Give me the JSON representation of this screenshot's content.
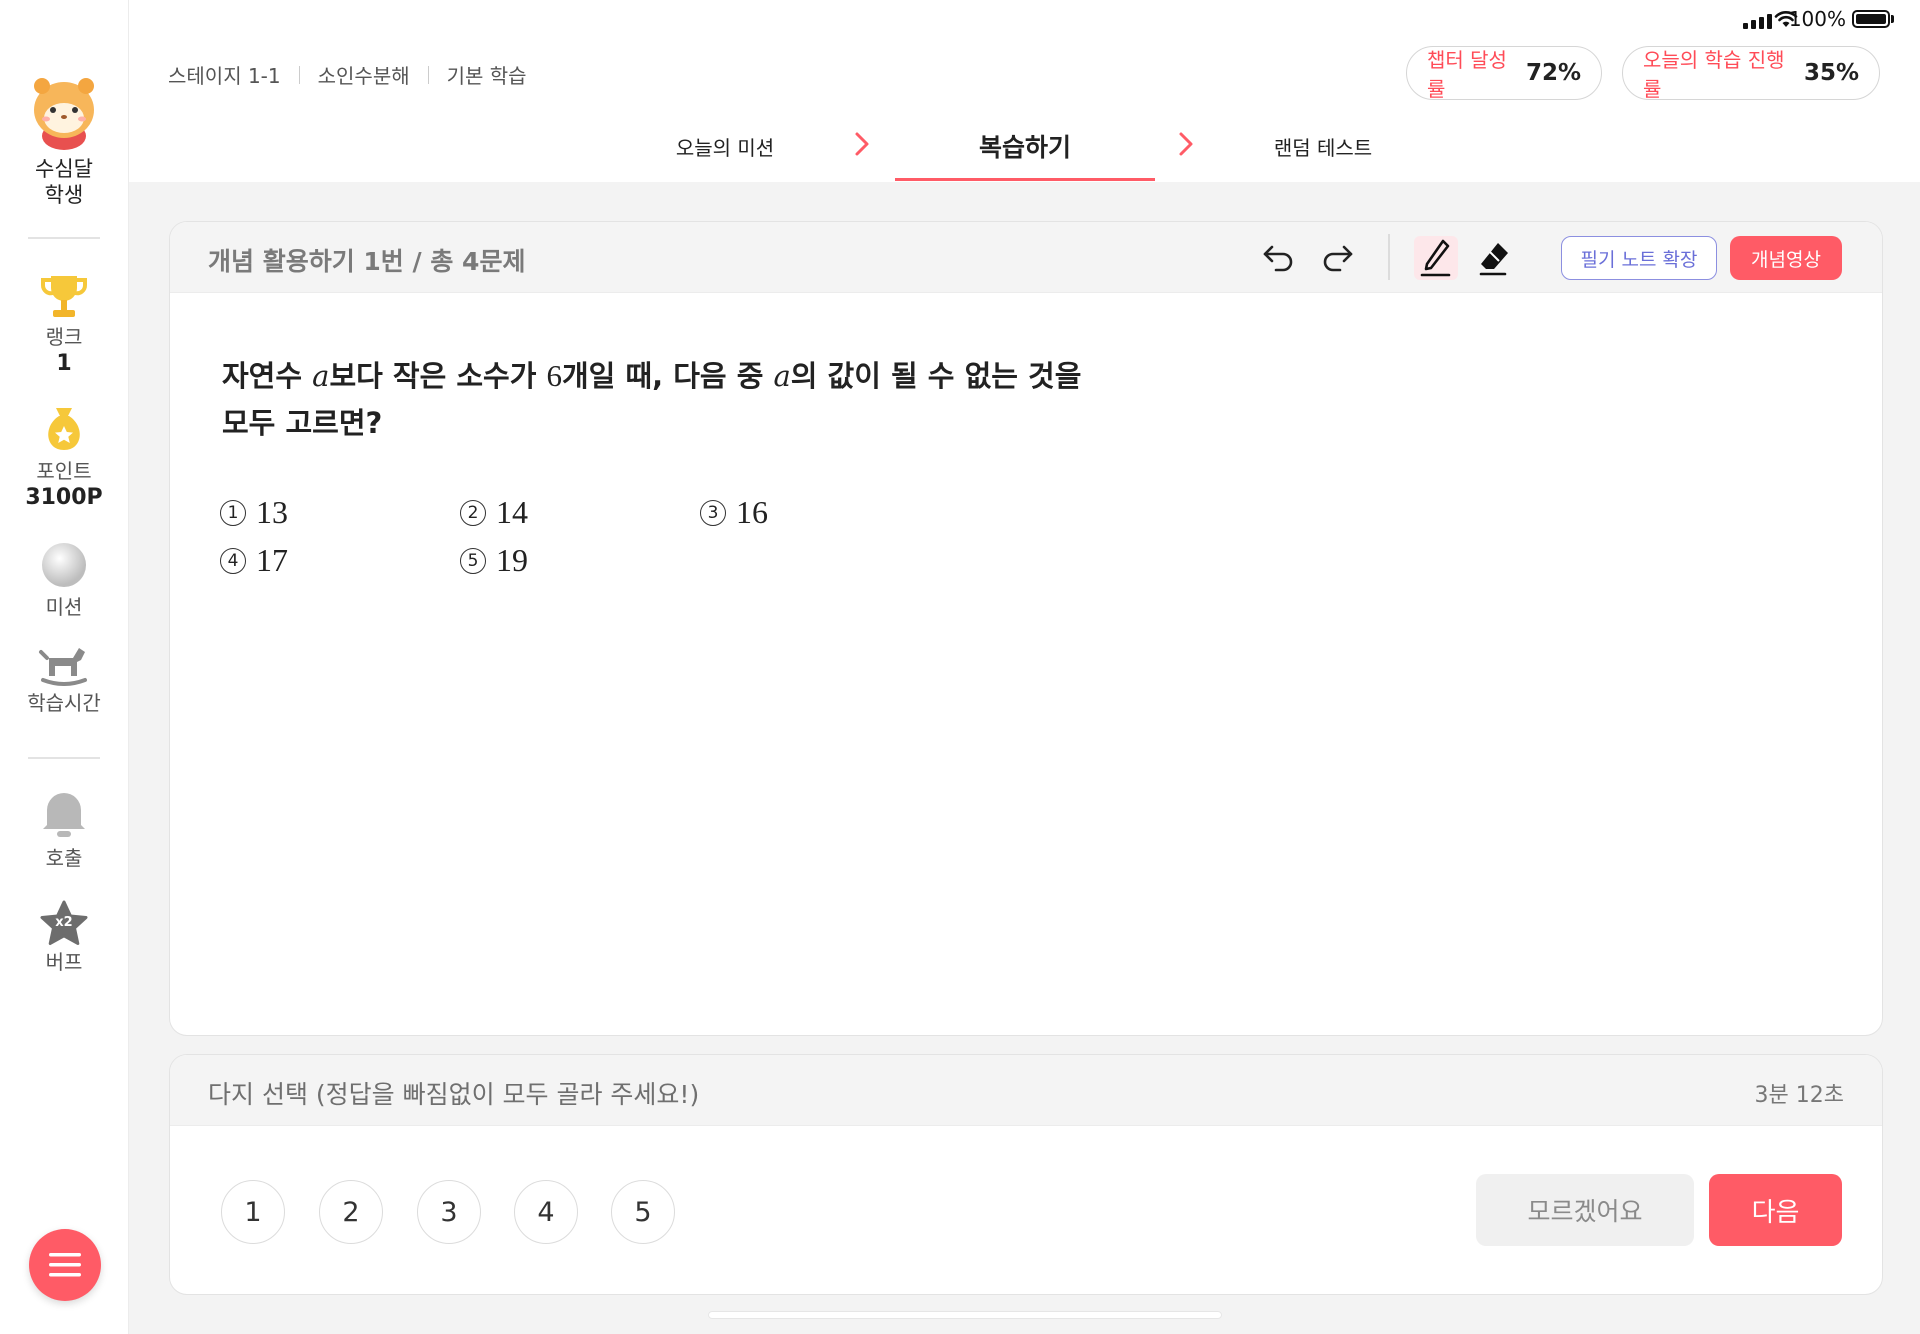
{
  "status_bar": {
    "battery_percent": "100%"
  },
  "sidebar": {
    "user_name": "수심달",
    "user_role": "학생",
    "rank_label": "랭크",
    "rank_value": "1",
    "points_label": "포인트",
    "points_value": "3100P",
    "mission_label": "미션",
    "study_time_label": "학습시간",
    "call_label": "호출",
    "buff_label": "버프",
    "buff_badge": "x2"
  },
  "header": {
    "breadcrumb": [
      "스테이지 1-1",
      "소인수분해",
      "기본 학습"
    ],
    "chapter_label": "챕터 달성률",
    "chapter_value": "72%",
    "today_label": "오늘의 학습 진행률",
    "today_value": "35%"
  },
  "tabs": [
    {
      "label": "오늘의 미션"
    },
    {
      "label": "복습하기",
      "active": true
    },
    {
      "label": "랜덤 테스트"
    }
  ],
  "problem": {
    "header_title": "개념 활용하기 1번 / 총 4문제",
    "note_button": "필기 노트 확장",
    "video_button": "개념영상",
    "q_part1": "자연수 ",
    "q_var1": "a",
    "q_part2": "보다 작은 소수가 ",
    "q_num": "6",
    "q_part3": "개일 때, 다음 중 ",
    "q_var2": "a",
    "q_part4": "의 값이 될 수 없는 것을",
    "q_line2": "모두 고르면?",
    "choices": [
      {
        "mark": "1",
        "value": "13"
      },
      {
        "mark": "2",
        "value": "14"
      },
      {
        "mark": "3",
        "value": "16"
      },
      {
        "mark": "4",
        "value": "17"
      },
      {
        "mark": "5",
        "value": "19"
      }
    ]
  },
  "answer": {
    "title": "다지 선택 (정답을 빠짐없이 모두 골라 주세요!)",
    "timer": "3분 12초",
    "options": [
      "1",
      "2",
      "3",
      "4",
      "5"
    ],
    "dunno_button": "모르겠어요",
    "next_button": "다음"
  },
  "colors": {
    "accent": "#ff5b66",
    "note_border": "#8c8fe0"
  }
}
